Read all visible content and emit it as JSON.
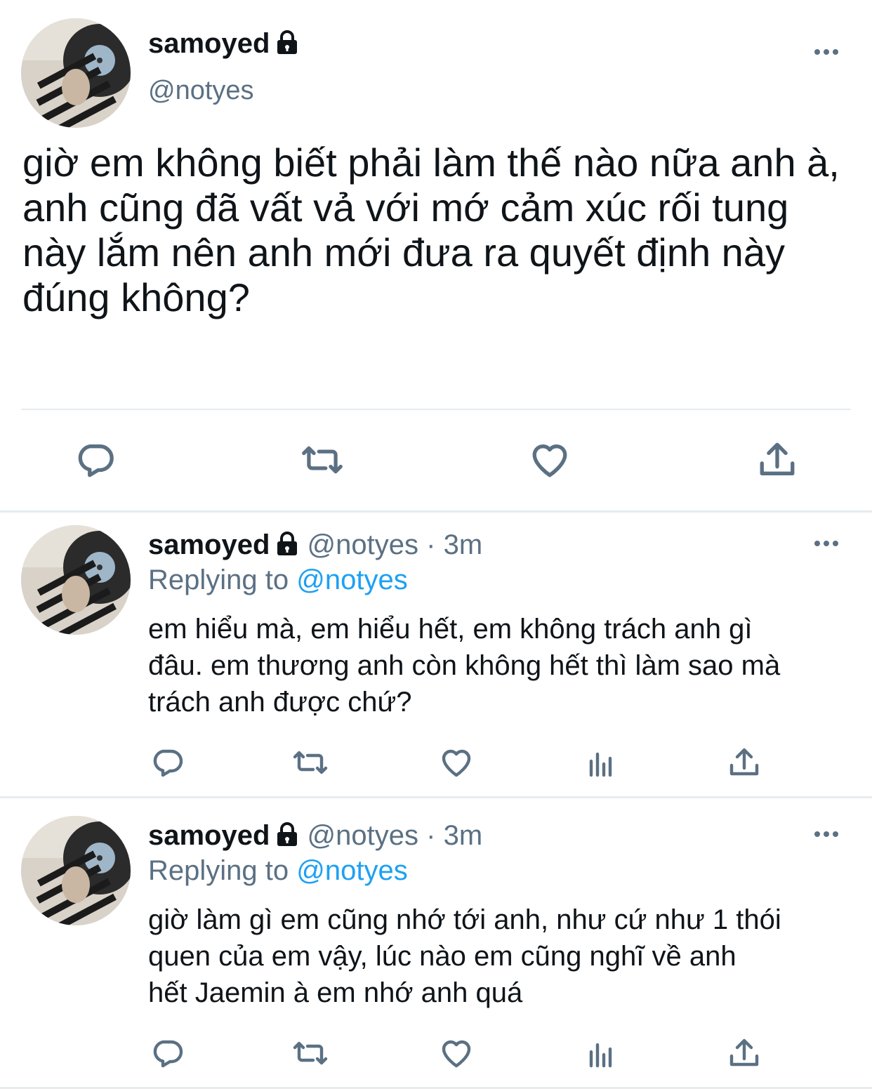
{
  "main_tweet": {
    "display_name": "samoyed",
    "handle": "@notyes",
    "text": "giờ em không biết phải làm thế nào nữa anh à,\nanh cũng đã vất vả với mớ cảm xúc rối tung\nnày lắm nên anh mới đưa ra quyết định này\nđúng không?",
    "icons": [
      "lock-icon",
      "more-icon",
      "reply-icon",
      "retweet-icon",
      "like-icon",
      "share-icon"
    ]
  },
  "replies": [
    {
      "display_name": "samoyed",
      "handle": "@notyes",
      "separator": "·",
      "time": "3m",
      "replying_prefix": "Replying to",
      "replying_to": "@notyes",
      "text": "em hiểu mà, em hiểu hết, em không trách anh gì\nđâu. em thương anh còn không hết thì làm sao mà\ntrách anh được chứ?"
    },
    {
      "display_name": "samoyed",
      "handle": "@notyes",
      "separator": "·",
      "time": "3m",
      "replying_prefix": "Replying to",
      "replying_to": "@notyes",
      "text": "giờ làm gì em cũng nhớ tới anh, như cứ như 1 thói\nquen của em vậy, lúc nào em cũng nghĩ về anh\nhết Jaemin à em nhớ anh quá"
    }
  ],
  "colors": {
    "text": "#0f1419",
    "secondary": "#5b7083",
    "link": "#1da1f2",
    "divider": "#e6ecf0"
  }
}
